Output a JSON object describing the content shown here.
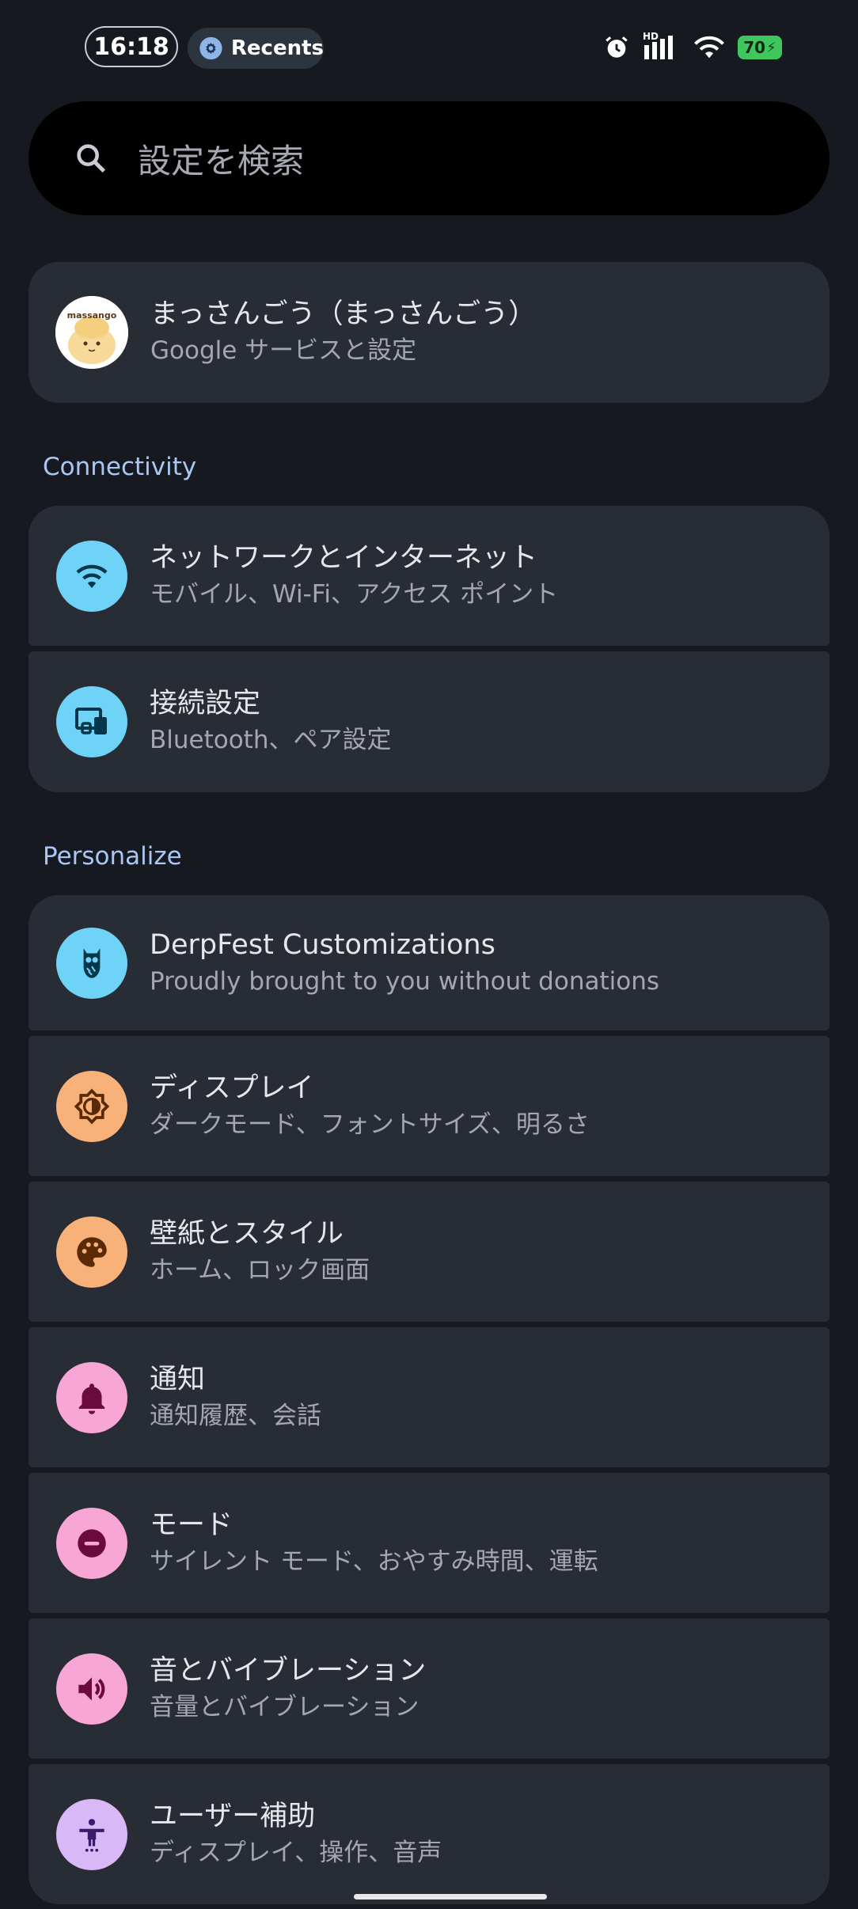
{
  "status_bar": {
    "time": "16:18",
    "recents_label": "Recents",
    "battery": "70",
    "network_label": "HD"
  },
  "search": {
    "placeholder": "設定を検索"
  },
  "account": {
    "title": "まっさんごう（まっさんごう）",
    "subtitle": "Google サービスと設定",
    "avatar_text": "massango"
  },
  "sections": {
    "connectivity": "Connectivity",
    "personalize": "Personalize"
  },
  "connectivity_items": [
    {
      "title": "ネットワークとインターネット",
      "subtitle": "モバイル、Wi-Fi、アクセス ポイント",
      "icon": "wifi-icon",
      "color": "#6fd3f7"
    },
    {
      "title": "接続設定",
      "subtitle": "Bluetooth、ペア設定",
      "icon": "devices-icon",
      "color": "#6fd3f7"
    }
  ],
  "personalize_items": [
    {
      "title": "DerpFest Customizations",
      "subtitle": "Proudly brought to you without donations",
      "icon": "owl-icon",
      "color": "#6fd3f7"
    },
    {
      "title": "ディスプレイ",
      "subtitle": "ダークモード、フォントサイズ、明るさ",
      "icon": "brightness-icon",
      "color": "#f9b17a"
    },
    {
      "title": "壁紙とスタイル",
      "subtitle": "ホーム、ロック画面",
      "icon": "palette-icon",
      "color": "#f9b17a"
    },
    {
      "title": "通知",
      "subtitle": "通知履歴、会話",
      "icon": "bell-icon",
      "color": "#f7a6d6"
    },
    {
      "title": "モード",
      "subtitle": "サイレント モード、おやすみ時間、運転",
      "icon": "do-not-disturb-icon",
      "color": "#f7a6d6"
    },
    {
      "title": "音とバイブレーション",
      "subtitle": "音量とバイブレーション",
      "icon": "volume-icon",
      "color": "#f7a6d6"
    },
    {
      "title": "ユーザー補助",
      "subtitle": "ディスプレイ、操作、音声",
      "icon": "accessibility-icon",
      "color": "#d9b8f7"
    }
  ]
}
